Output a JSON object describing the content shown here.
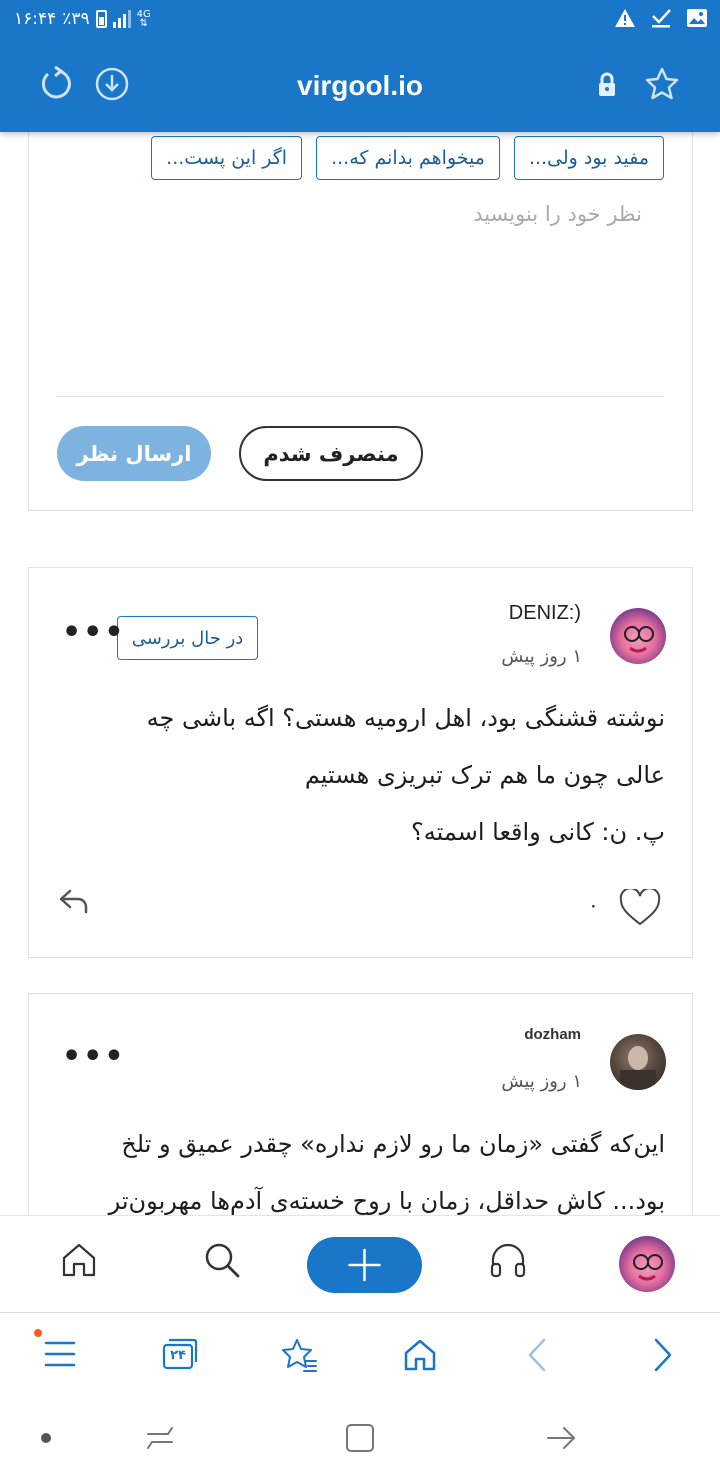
{
  "status_bar": {
    "time": "۱۶:۴۴",
    "battery": "٪۳۹",
    "network": "4G"
  },
  "header": {
    "url": "virgool.io",
    "icons": [
      "refresh-icon",
      "download-icon",
      "lock-icon",
      "star-icon"
    ]
  },
  "comment_form": {
    "chips": [
      "مفید بود ولی...",
      "میخواهم بدانم که...",
      "اگر این پست..."
    ],
    "placeholder": "نظر خود را بنویسید",
    "cancel_label": "منصرف شدم",
    "submit_label": "ارسال نظر"
  },
  "comments": [
    {
      "author": "DENIZ:)",
      "time": "۱ روز پیش",
      "badge": "در حال بررسی",
      "lines": [
        "نوشته قشنگی بود، اهل ارومیه هستی؟ اگه باشی چه",
        "عالی چون ما هم ترک تبریزی هستیم",
        "پ. ن: کانی واقعا اسمته؟"
      ],
      "likes": "۰"
    },
    {
      "author": "dozham",
      "time": "۱ روز پیش",
      "lines": [
        "این‌که گفتی «زمان ما رو لازم نداره» چقدر عمیق و تلخ",
        "بود... کاش حداقل، زمان با روح خسته‌ی آدم‌ها مهربون‌تر"
      ]
    }
  ],
  "app_nav": {
    "items": [
      "home-icon",
      "search-icon",
      "add-icon",
      "headphones-icon",
      "avatar"
    ]
  },
  "browser_nav": {
    "tabs_count": "۲۴",
    "items": [
      "menu-icon",
      "tabs-icon",
      "bookmarks-icon",
      "home-icon",
      "back-icon",
      "forward-icon"
    ]
  },
  "colors": {
    "accent": "#1976c8",
    "submit_disabled": "#7eb3e0"
  }
}
